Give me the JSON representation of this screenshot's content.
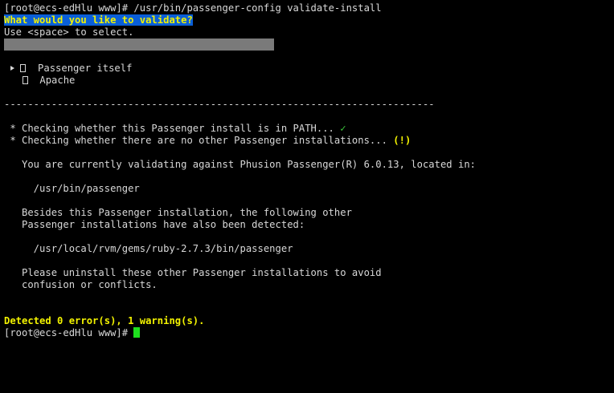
{
  "terminal": {
    "prompt_user_host": "[root@ecs-edHlu www]#",
    "command": " /usr/bin/passenger-config validate-install",
    "question": "What would you like to validate?",
    "hint": "Use <space> to select.",
    "options": [
      {
        "label": "Passenger itself",
        "selected": false,
        "focused": true
      },
      {
        "label": "Apache",
        "selected": false,
        "focused": false
      }
    ],
    "separator": "-------------------------------------------------------------------------",
    "check1": " * Checking whether this Passenger install is in PATH... ",
    "check1_status": "✓",
    "check2": " * Checking whether there are no other Passenger installations... ",
    "check2_status": "(!)",
    "validating_msg": "   You are currently validating against Phusion Passenger(R) 6.0.13, located in:",
    "passenger_path": "     /usr/bin/passenger",
    "besides_line1": "   Besides this Passenger installation, the following other",
    "besides_line2": "   Passenger installations have also been detected:",
    "other_path": "     /usr/local/rvm/gems/ruby-2.7.3/bin/passenger",
    "uninstall_line1": "   Please uninstall these other Passenger installations to avoid",
    "uninstall_line2": "   confusion or conflicts.",
    "summary": "Detected 0 error(s), 1 warning(s).",
    "final_prompt": "[root@ecs-edHlu www]# "
  },
  "colors": {
    "background": "#000000",
    "text": "#d8d8d8",
    "highlight_bg": "#0a5fd8",
    "highlight_fg": "#f2f200",
    "ok": "#3fd23f",
    "warning": "#f2f200",
    "cursor": "#1ee01e",
    "selection_bar": "#7a7a7a"
  }
}
